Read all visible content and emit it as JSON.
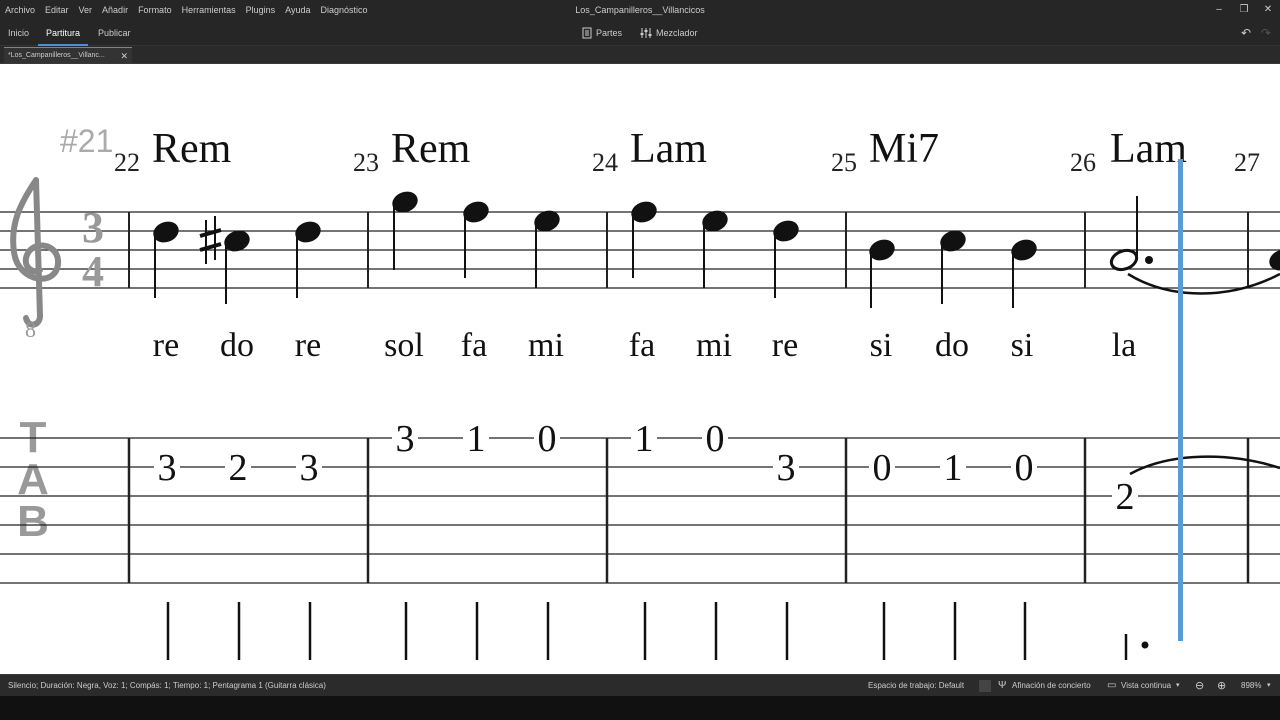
{
  "menubar": {
    "items": [
      "Archivo",
      "Editar",
      "Ver",
      "Añadir",
      "Formato",
      "Herramientas",
      "Plugins",
      "Ayuda",
      "Diagnóstico"
    ],
    "window_title": "Los_Campanilleros__Villancicos"
  },
  "toolbar": {
    "tabs": [
      "Inicio",
      "Partitura",
      "Publicar"
    ],
    "active_tab": "Partitura",
    "parts_label": "Partes",
    "mixer_label": "Mezclador"
  },
  "document_tab": {
    "label": "*Los_Campanilleros__Villanc..."
  },
  "score": {
    "system_measure_label": "#21",
    "clef_octave": "8",
    "time_signature": {
      "top": "3",
      "bottom": "4"
    },
    "measures": [
      {
        "number": "22",
        "chord": "Rem",
        "lyrics": [
          "re",
          "do",
          "re"
        ],
        "tab": [
          "3",
          "2",
          "3"
        ]
      },
      {
        "number": "23",
        "chord": "Rem",
        "lyrics": [
          "sol",
          "fa",
          "mi"
        ],
        "tab": [
          "3",
          "1",
          "0"
        ]
      },
      {
        "number": "24",
        "chord": "Lam",
        "lyrics": [
          "fa",
          "mi",
          "re"
        ],
        "tab": [
          "1",
          "0",
          "3"
        ]
      },
      {
        "number": "25",
        "chord": "Mi7",
        "lyrics": [
          "si",
          "do",
          "si"
        ],
        "tab": [
          "0",
          "1",
          "0"
        ]
      },
      {
        "number": "26",
        "chord": "Lam",
        "lyrics": [
          "la"
        ],
        "tab": [
          "2"
        ]
      },
      {
        "number": "27",
        "chord": "",
        "lyrics": [],
        "tab": []
      }
    ]
  },
  "statusbar": {
    "status_text": "Silencio; Duración: Negra, Voz: 1; Compás: 1; Tiempo: 1; Pentagrama 1 (Guitarra clásica)",
    "workspace": "Espacio de trabajo: Default",
    "concert_pitch": "Afinación de concierto",
    "view_mode": "Vista continua",
    "zoom": "898%"
  }
}
